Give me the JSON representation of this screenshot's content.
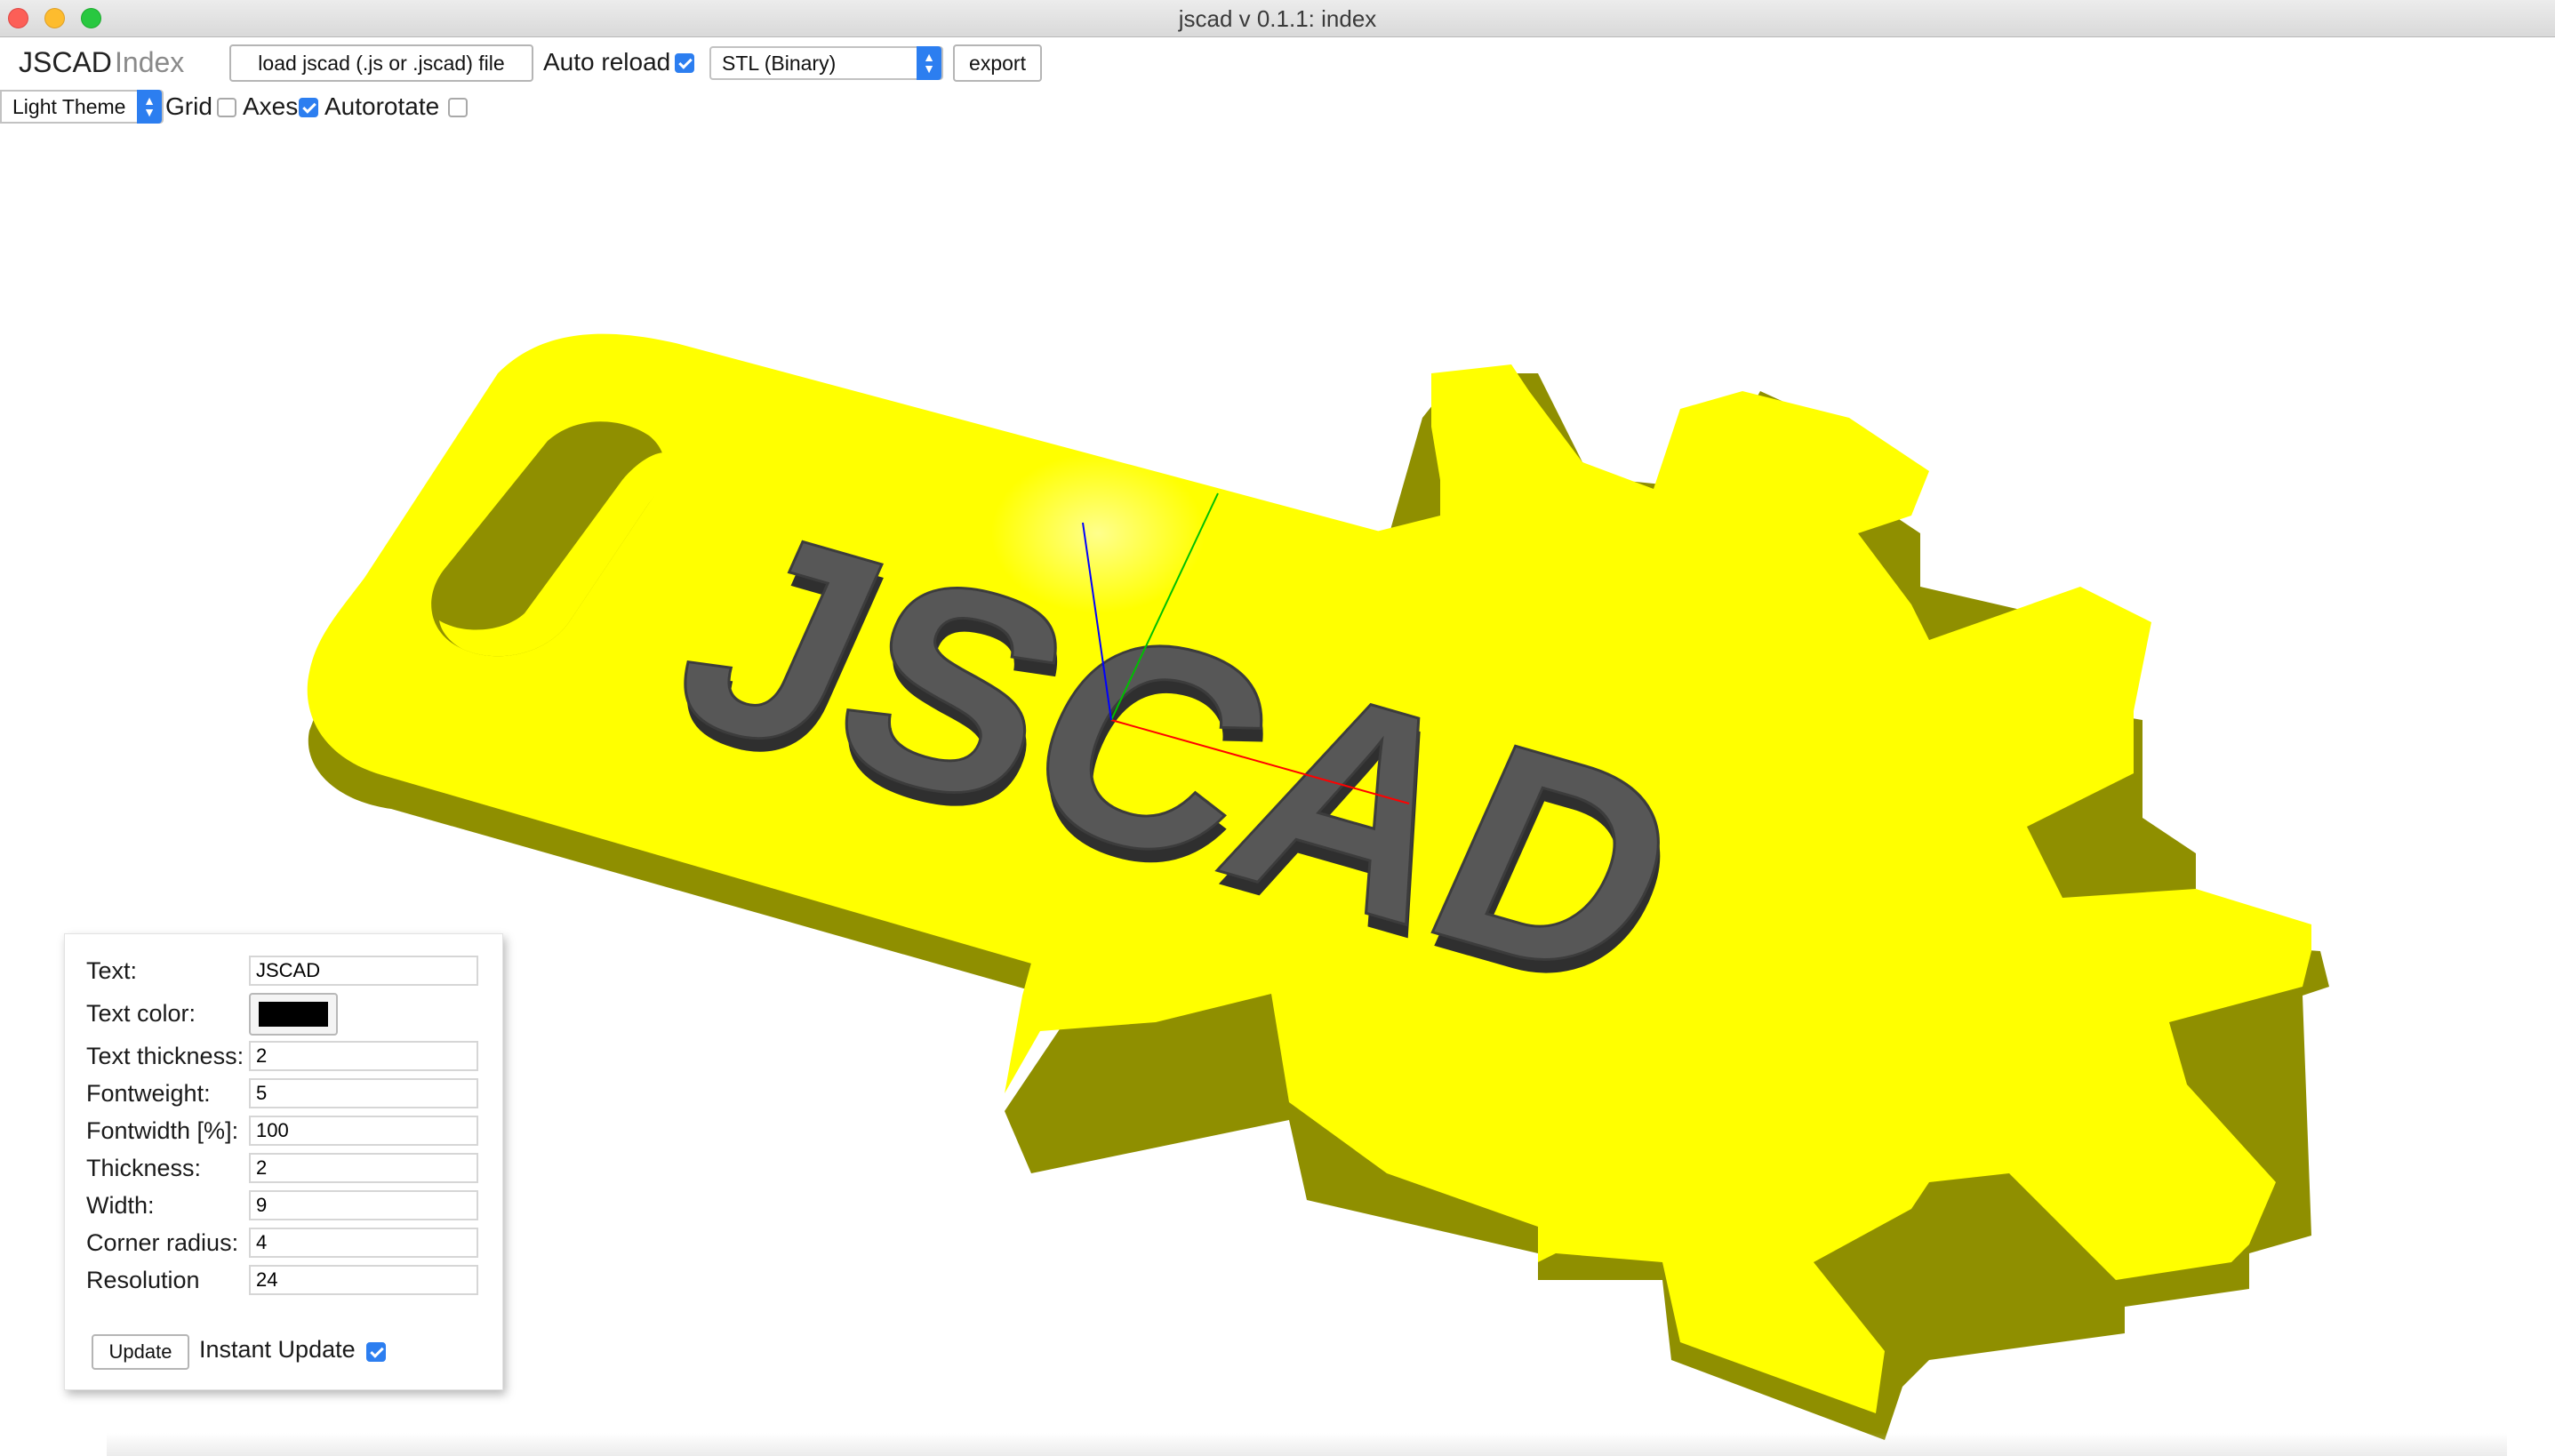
{
  "window": {
    "title": "jscad v 0.1.1: index"
  },
  "toolbar": {
    "brand": "JSCAD",
    "page": "Index",
    "load_button": "load jscad (.js or .jscad) file",
    "auto_reload_label": "Auto reload",
    "auto_reload_checked": true,
    "export_format": "STL (Binary)",
    "export_button": "export"
  },
  "view_options": {
    "theme": "Light Theme",
    "grid_label": "Grid",
    "grid_checked": false,
    "axes_label": "Axes",
    "axes_checked": true,
    "autorotate_label": "Autorotate",
    "autorotate_checked": false
  },
  "viewport": {
    "model_text": "JSCAD",
    "model_color": "#ffff00",
    "text_color": "#555555",
    "axis_colors": {
      "x": "#ff0000",
      "y": "#00c000",
      "z": "#0000ff"
    }
  },
  "parameters": {
    "text_label": "Text:",
    "text_value": "JSCAD",
    "text_color_label": "Text color:",
    "text_color_value": "#000000",
    "text_thickness_label": "Text thickness:",
    "text_thickness_value": "2",
    "fontweight_label": "Fontweight:",
    "fontweight_value": "5",
    "fontwidth_label": "Fontwidth [%]:",
    "fontwidth_value": "100",
    "thickness_label": "Thickness:",
    "thickness_value": "2",
    "width_label": "Width:",
    "width_value": "9",
    "corner_radius_label": "Corner radius:",
    "corner_radius_value": "4",
    "resolution_label": "Resolution",
    "resolution_value": "24",
    "update_button": "Update",
    "instant_update_label": "Instant Update",
    "instant_update_checked": true
  }
}
